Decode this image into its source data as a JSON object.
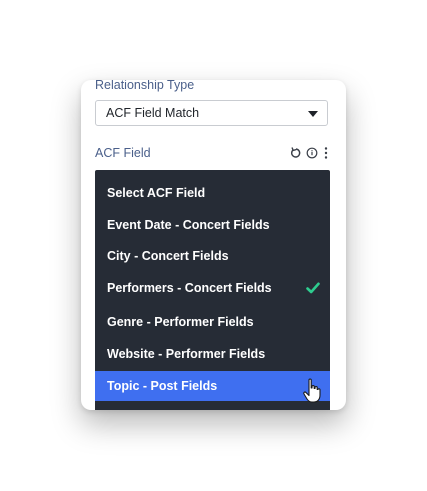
{
  "relationship_type": {
    "label": "Relationship Type",
    "value": "ACF Field Match"
  },
  "acf_field": {
    "label": "ACF Field",
    "tool_icons": [
      "reset-icon",
      "info-icon",
      "more-vertical-icon"
    ]
  },
  "dropdown": {
    "options": [
      "Select ACF Field",
      "Event Date - Concert Fields",
      "City - Concert Fields",
      "Performers - Concert Fields",
      "Genre - Performer Fields",
      "Website - Performer Fields",
      "Topic - Post Fields"
    ],
    "checked_option": "Performers - Concert Fields",
    "highlighted_option": "Topic - Post Fields"
  },
  "colors": {
    "label_blue": "#4a5f8a",
    "dropdown_bg": "#262c36",
    "highlight_blue": "#3f6ff0",
    "check_green": "#2ecc8f"
  }
}
